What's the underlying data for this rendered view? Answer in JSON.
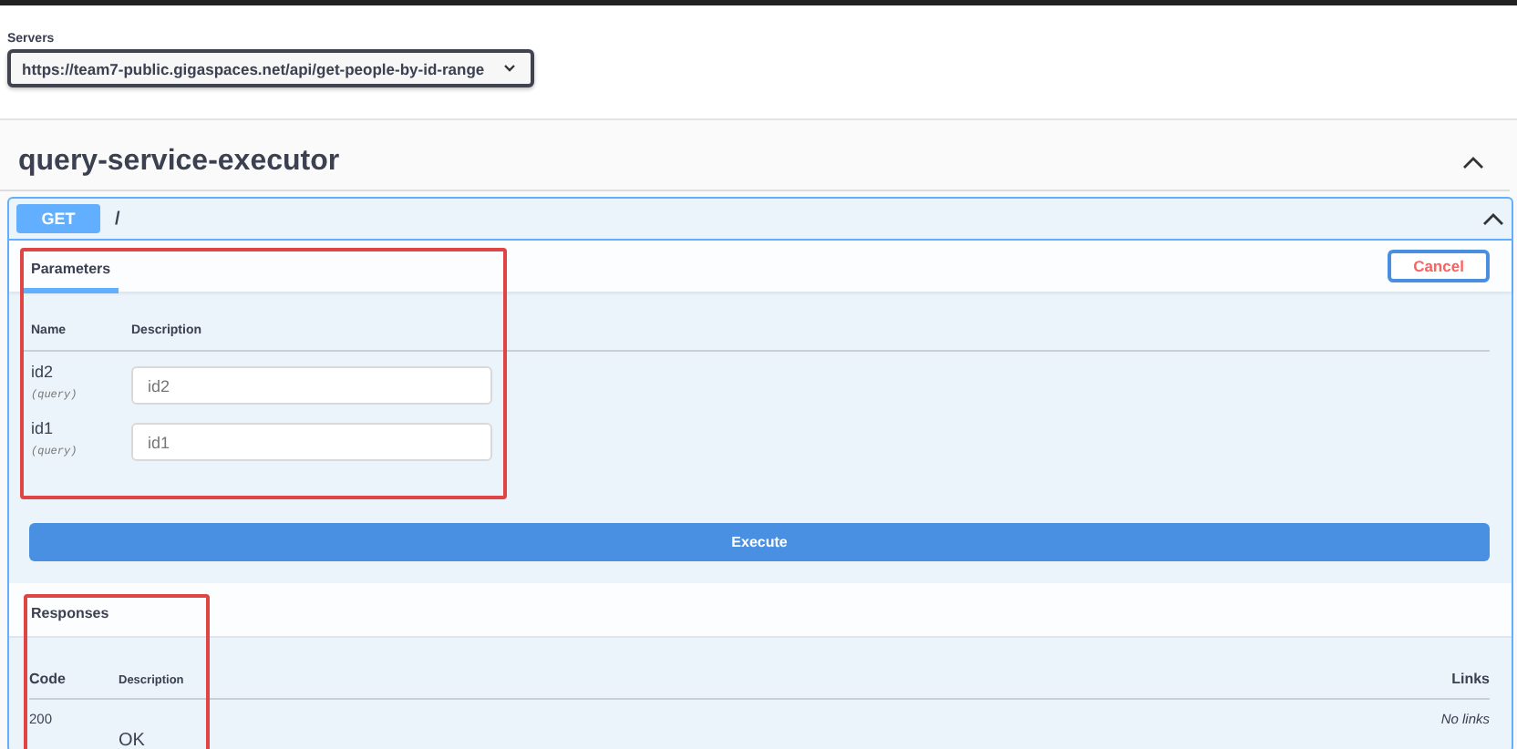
{
  "servers": {
    "label": "Servers",
    "selected_server": "https://team7-public.gigaspaces.net/api/get-people-by-id-range"
  },
  "tag": {
    "title": "query-service-executor",
    "expanded": true
  },
  "operation": {
    "method": "GET",
    "path": "/",
    "expanded": true,
    "parameters": {
      "tab": "Parameters",
      "cancel": "Cancel",
      "columns": [
        "Name",
        "Description"
      ],
      "rows": [
        {
          "name": "id2",
          "location": "(query)",
          "placeholder": "id2"
        },
        {
          "name": "id1",
          "location": "(query)",
          "placeholder": "id1"
        }
      ]
    },
    "execute": "Execute",
    "responses": {
      "title": "Responses",
      "columns": [
        "Code",
        "Description",
        "Links"
      ],
      "rows": [
        {
          "code": "200",
          "description": "OK",
          "links": "No links"
        }
      ]
    }
  }
}
